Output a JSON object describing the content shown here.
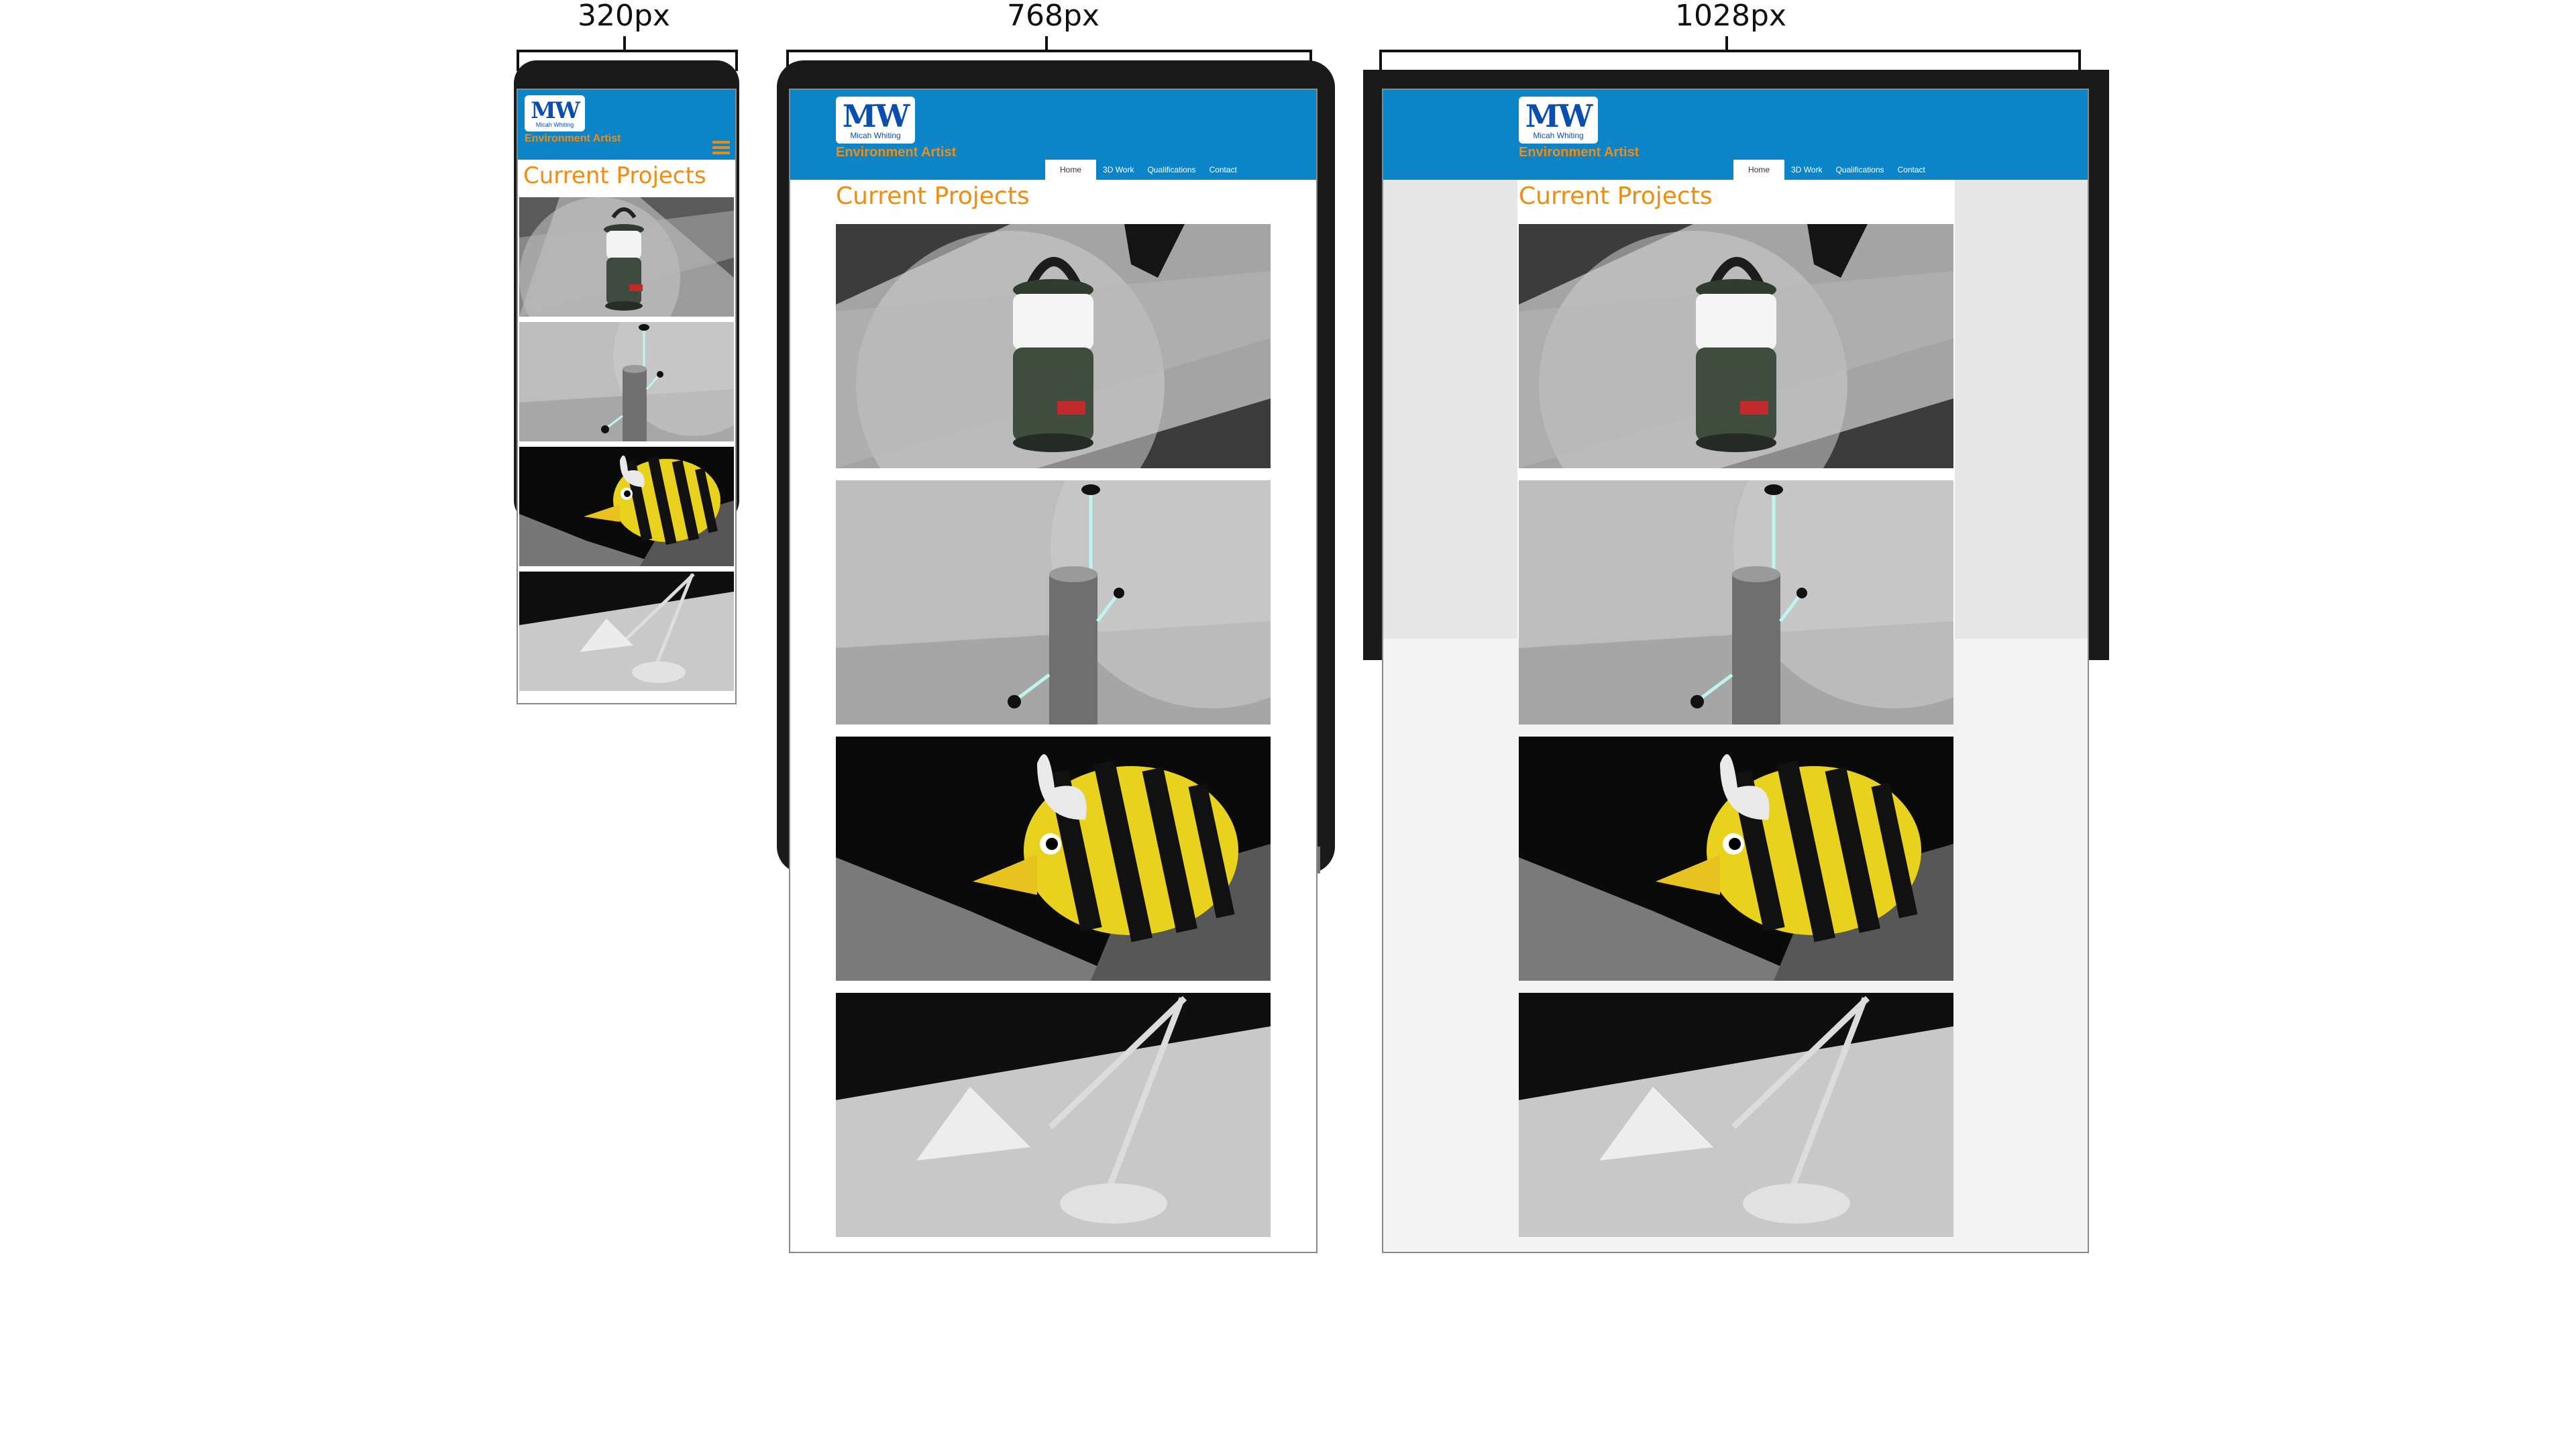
{
  "labels": {
    "small": "320px",
    "medium": "768px",
    "large": "1028px"
  },
  "site": {
    "logo_mark": "MW",
    "logo_name": "Micah Whiting",
    "role": "Environment Artist",
    "heading": "Current Projects",
    "nav": [
      "Home",
      "3D Work",
      "Qualifications",
      "Contact"
    ],
    "active_nav": "Home",
    "projects": [
      "lantern-render",
      "post-render",
      "fish-render",
      "desk-lamp-render"
    ]
  },
  "colors": {
    "header_blue": "#0c84c8",
    "accent_orange": "#f08c12",
    "frame": "#1a1a1a"
  }
}
